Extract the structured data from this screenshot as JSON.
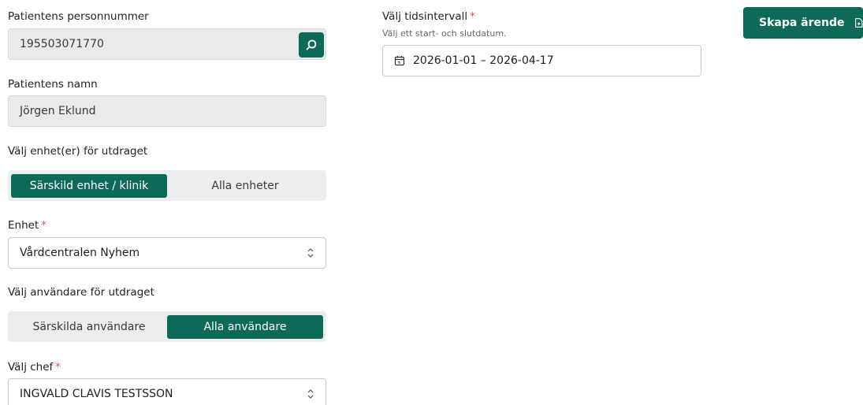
{
  "colors": {
    "accent": "#0d6a58",
    "required": "#d9534f",
    "disabled_bg": "#e9eaeb",
    "segment_bg": "#ecedee"
  },
  "personnummer": {
    "label": "Patientens personnummer",
    "value": "195503071770",
    "search_icon": "search-icon"
  },
  "namn": {
    "label": "Patientens namn",
    "value": "Jörgen Eklund"
  },
  "enhet_scope": {
    "label": "Välj enhet(er) för utdraget",
    "options": [
      "Särskild enhet / klinik",
      "Alla enheter"
    ],
    "selected": "Särskild enhet / klinik"
  },
  "enhet": {
    "label": "Enhet",
    "required_mark": "*",
    "value": "Vårdcentralen Nyhem",
    "icon": "chevron-updown-icon"
  },
  "anvandare_scope": {
    "label": "Välj användare för utdraget",
    "options": [
      "Särskilda användare",
      "Alla användare"
    ],
    "selected": "Alla användare"
  },
  "chef": {
    "label": "Välj chef",
    "required_mark": "*",
    "value": "INGVALD CLAVIS TESTSSON",
    "icon": "chevron-updown-icon"
  },
  "tidsintervall": {
    "label": "Välj tidsintervall",
    "required_mark": "*",
    "hint": "Välj ett start- och slutdatum.",
    "value": "2026-01-01 – 2026-04-17",
    "icon": "calendar-icon"
  },
  "actions": {
    "create_label": "Skapa ärende",
    "create_icon": "file-plus-icon"
  }
}
